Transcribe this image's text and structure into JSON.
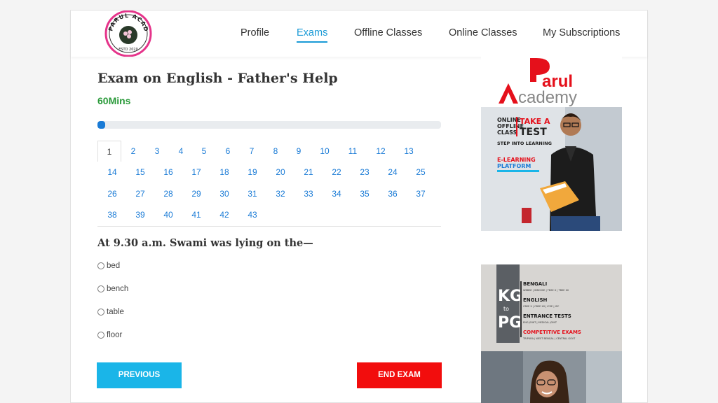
{
  "nav": {
    "logo_text": "PARUL ACADEMY · ESTD 2020",
    "items": [
      {
        "label": "Profile"
      },
      {
        "label": "Exams"
      },
      {
        "label": "Offline Classes"
      },
      {
        "label": "Online Classes"
      },
      {
        "label": "My Subscriptions"
      }
    ],
    "active": "Exams"
  },
  "exam": {
    "title": "Exam on English - Father's Help",
    "duration": "60Mins",
    "progress_fraction": 0.0233,
    "question_numbers": [
      "1",
      "2",
      "3",
      "4",
      "5",
      "6",
      "7",
      "8",
      "9",
      "10",
      "11",
      "12",
      "13",
      "14",
      "15",
      "16",
      "17",
      "18",
      "19",
      "20",
      "21",
      "22",
      "23",
      "24",
      "25",
      "26",
      "27",
      "28",
      "29",
      "30",
      "31",
      "32",
      "33",
      "34",
      "35",
      "36",
      "37",
      "38",
      "39",
      "40",
      "41",
      "42",
      "43"
    ],
    "current_question": "1",
    "question_text": "At 9.30 a.m. Swami was lying on the—",
    "options": [
      "bed",
      "bench",
      "table",
      "floor"
    ],
    "previous_label": "PREVIOUS",
    "end_label": "END EXAM"
  },
  "ads": {
    "ad1": {
      "brand_line1": "arul",
      "brand_line2": "cademy",
      "left_text": [
        "ONLINE",
        "OFFLINE",
        "CLASS"
      ],
      "headline": [
        "TAKE A",
        "TEST"
      ],
      "tagline": "STEP INTO LEARNING",
      "platform": [
        "E-LEARNING",
        "PLATFORM"
      ]
    },
    "ad2": {
      "kg": "KG",
      "to": "to",
      "pg": "PG",
      "subjects": [
        {
          "name": "BENGALI",
          "sub": "WBBSE | WBCHSE | TBSE X | TBSE XII"
        },
        {
          "name": "ENGLISH",
          "sub": "CBSE X | CBSE XII | ICSE | ISC"
        },
        {
          "name": "ENTRANCE TESTS",
          "sub": "ENG JOINT | MEDICAL JOINT"
        },
        {
          "name": "COMPETITIVE EXAMS",
          "sub": "TRIPURA | WEST BENGAL | CENTRAL GOVT"
        }
      ]
    }
  },
  "colors": {
    "accent": "#1a9ad6",
    "timer": "#2a9a3a",
    "previous": "#1ab5e8",
    "end": "#f20d0d",
    "brand_red": "#e5101b"
  }
}
